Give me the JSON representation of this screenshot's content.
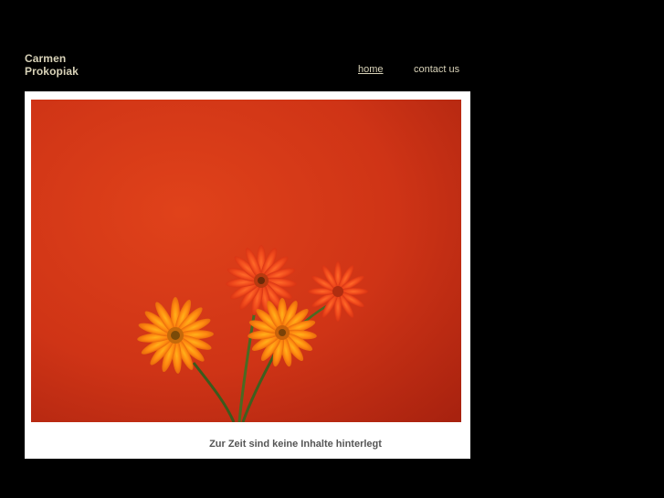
{
  "site": {
    "name_line1": "Carmen",
    "name_line2": "Prokopiak"
  },
  "nav": {
    "items": [
      {
        "label": "home",
        "active": true
      },
      {
        "label": "contact us",
        "active": false
      }
    ]
  },
  "main": {
    "photo_subject": "orange-gerbera-flowers-on-red-wall",
    "caption": "Zur Zeit sind keine Inhalte hinterlegt"
  },
  "colors": {
    "background": "#000000",
    "logo_text": "#d8d2b8",
    "nav_text": "#d8d2b8",
    "card": "#ffffff",
    "caption_text": "#555555",
    "wall_red": "#d13a1a"
  }
}
